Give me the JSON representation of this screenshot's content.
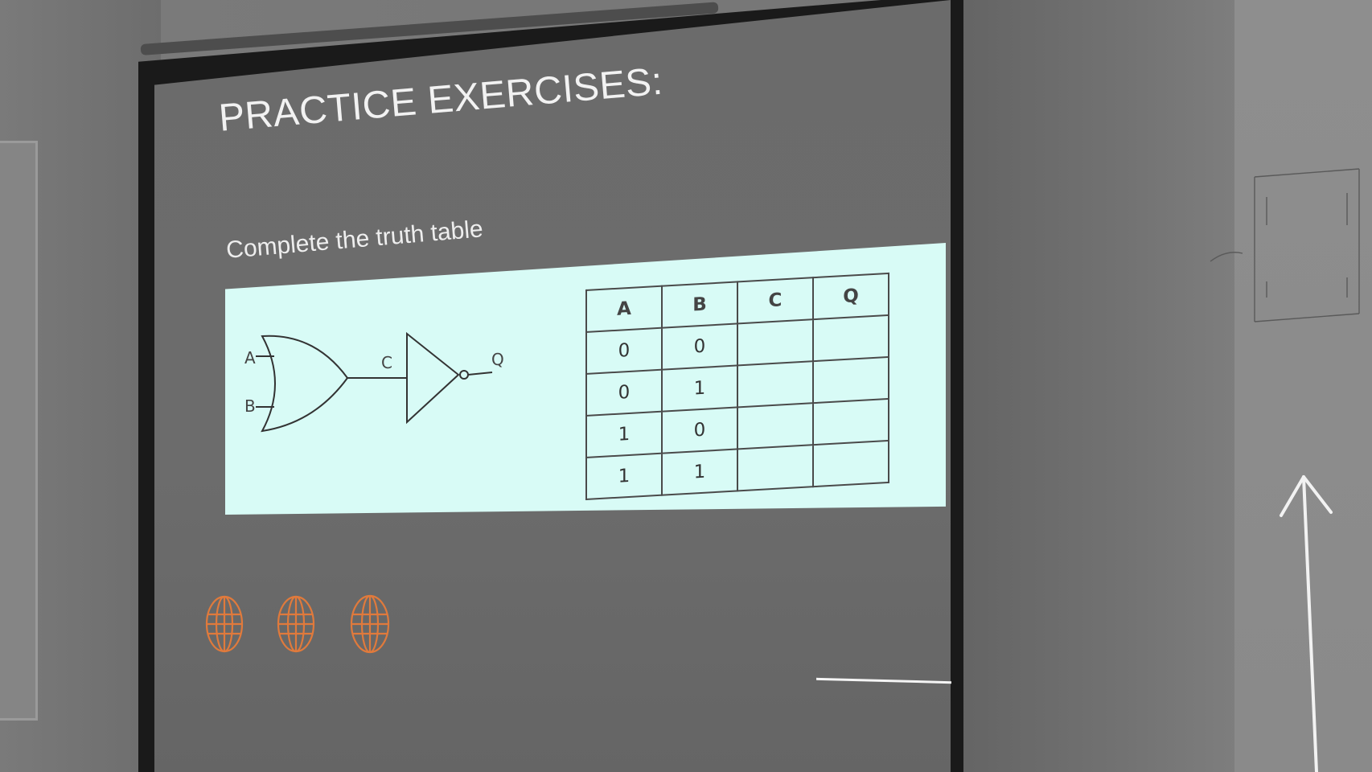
{
  "slide": {
    "title": "PRACTICE EXERCISES:",
    "subtitle": "Complete the truth table"
  },
  "circuit": {
    "input_a": "A",
    "input_b": "B",
    "middle": "C",
    "output": "Q"
  },
  "truth_table": {
    "headers": [
      "A",
      "B",
      "C",
      "Q"
    ],
    "rows": [
      [
        "0",
        "0",
        "",
        ""
      ],
      [
        "0",
        "1",
        "",
        ""
      ],
      [
        "1",
        "0",
        "",
        ""
      ],
      [
        "1",
        "1",
        "",
        ""
      ]
    ]
  },
  "colors": {
    "panel": "#d8fbf6",
    "globe": "#e07a3c",
    "screen": "#6b6b6b"
  }
}
